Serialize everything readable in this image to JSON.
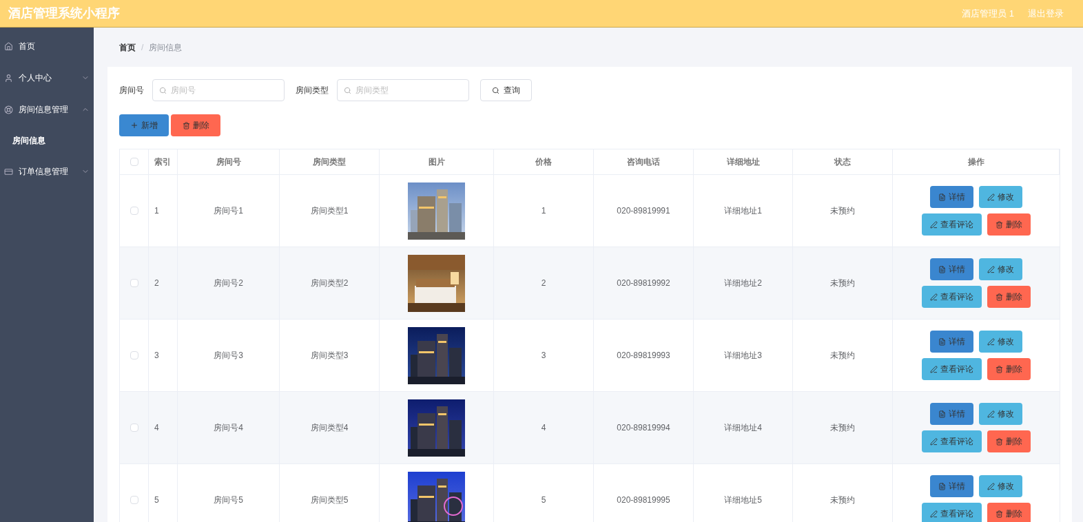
{
  "header": {
    "title": "酒店管理系统小程序",
    "user": "酒店管理员 1",
    "logout": "退出登录"
  },
  "sidebar": {
    "items": [
      {
        "label": "首页",
        "kind": "link"
      },
      {
        "label": "个人中心",
        "kind": "group",
        "expanded": false
      },
      {
        "label": "房间信息管理",
        "kind": "group",
        "expanded": true,
        "children": [
          {
            "label": "房间信息"
          }
        ]
      },
      {
        "label": "订单信息管理",
        "kind": "group",
        "expanded": false
      }
    ]
  },
  "breadcrumb": {
    "items": [
      "首页",
      "房间信息"
    ],
    "separator": "/"
  },
  "filters": [
    {
      "label": "房间号",
      "placeholder": "房间号"
    },
    {
      "label": "房间类型",
      "placeholder": "房间类型"
    }
  ],
  "search_button": "查询",
  "add_button": "新增",
  "delete_button": "删除",
  "table": {
    "select_all_checked": false,
    "columns": [
      "索引",
      "房间号",
      "房间类型",
      "图片",
      "价格",
      "咨询电话",
      "详细地址",
      "状态",
      "操作"
    ],
    "rows": [
      {
        "checked": false,
        "index": "1",
        "room": "房间号1",
        "type": "房间类型1",
        "picture": {
          "kind": "picture"
        },
        "price": "1",
        "phone": "020-89819991",
        "address": "详细地址1",
        "status": "未预约",
        "actions": [
          "详情",
          "修改",
          "查看评论",
          "删除"
        ]
      },
      {
        "checked": false,
        "index": "2",
        "room": "房间号2",
        "type": "房间类型2",
        "picture": {
          "kind": "picture"
        },
        "price": "2",
        "phone": "020-89819992",
        "address": "详细地址2",
        "status": "未预约",
        "actions": [
          "详情",
          "修改",
          "查看评论",
          "删除"
        ]
      },
      {
        "checked": false,
        "index": "3",
        "room": "房间号3",
        "type": "房间类型3",
        "picture": {
          "kind": "picture"
        },
        "price": "3",
        "phone": "020-89819993",
        "address": "详细地址3",
        "status": "未预约",
        "actions": [
          "详情",
          "修改",
          "查看评论",
          "删除"
        ]
      },
      {
        "checked": false,
        "index": "4",
        "room": "房间号4",
        "type": "房间类型4",
        "picture": {
          "kind": "picture"
        },
        "price": "4",
        "phone": "020-89819994",
        "address": "详细地址4",
        "status": "未预约",
        "actions": [
          "详情",
          "修改",
          "查看评论",
          "删除"
        ]
      },
      {
        "checked": false,
        "index": "5",
        "room": "房间号5",
        "type": "房间类型5",
        "picture": {
          "kind": "picture"
        },
        "price": "5",
        "phone": "020-89819995",
        "address": "详细地址5",
        "status": "未预约",
        "actions": [
          "详情",
          "修改",
          "查看评论",
          "删除"
        ]
      }
    ]
  }
}
